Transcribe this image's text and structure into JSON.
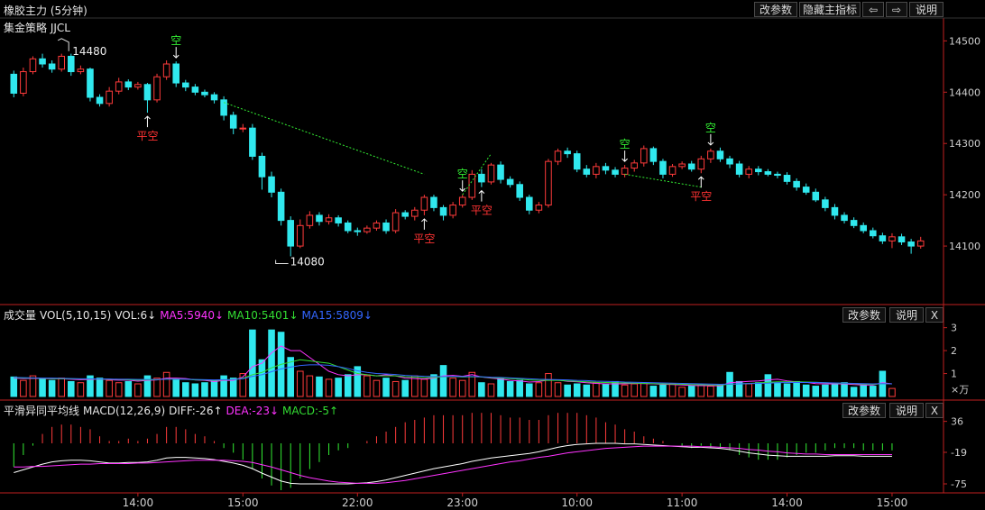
{
  "header": {
    "title": "橡胶主力 (5分钟)",
    "strategy": "集金策略 JJCL",
    "buttons": {
      "edit_params": "改参数",
      "hide_indicator": "隐藏主指标",
      "left_arrow": "⇦",
      "right_arrow": "⇨",
      "explain": "说明"
    }
  },
  "volume_panel": {
    "label": "成交量",
    "indicator": "VOL(5,10,15)",
    "vol": "VOL:6↓",
    "ma5": "MA5:5940↓",
    "ma10": "MA10:5401↓",
    "ma15": "MA15:5809↓",
    "edit_params": "改参数",
    "explain": "说明",
    "close": "X",
    "unit": "×万"
  },
  "macd_panel": {
    "label": "平滑异同平均线",
    "indicator": "MACD(12,26,9)",
    "diff": "DIFF:-26↑",
    "dea": "DEA:-23↓",
    "macd": "MACD:-5↑",
    "edit_params": "改参数",
    "explain": "说明",
    "close": "X"
  },
  "colors": {
    "up": "#ff3b3b",
    "down": "#30e8ee",
    "ma5": "#ff33ff",
    "ma10": "#33dd33",
    "ma15": "#3366ff",
    "diff": "#ffffff",
    "dea": "#ff33ff",
    "signal_short": "#33ee33",
    "signal_cover": "#ff3333",
    "trend": "#33ee33"
  },
  "chart_data": {
    "type": "candlestick",
    "price_axis": {
      "ticks": [
        14100,
        14200,
        14300,
        14400,
        14500
      ],
      "ylim": [
        14000,
        14520
      ]
    },
    "volume_axis": {
      "ticks": [
        1,
        2,
        3
      ],
      "ylim": [
        0,
        3.3
      ]
    },
    "macd_axis": {
      "ticks": [
        36,
        -19,
        -75
      ],
      "ylim": [
        -83,
        45
      ]
    },
    "time_ticks": [
      {
        "label": "14:00",
        "index": 13
      },
      {
        "label": "15:00",
        "index": 24
      },
      {
        "label": "22:00",
        "index": 36
      },
      {
        "label": "23:00",
        "index": 47
      },
      {
        "label": "10:00",
        "index": 59
      },
      {
        "label": "11:00",
        "index": 70
      },
      {
        "label": "14:00",
        "index": 81
      },
      {
        "label": "15:00",
        "index": 92
      }
    ],
    "annotations": {
      "high_label": {
        "text": "14480",
        "index": 5,
        "price": 14480
      },
      "low_label": {
        "text": "14080",
        "index": 28,
        "price": 14080
      }
    },
    "signals": [
      {
        "index": 14,
        "text": "平空",
        "type": "cover"
      },
      {
        "index": 17,
        "text": "空",
        "type": "short"
      },
      {
        "index": 43,
        "text": "平空",
        "type": "cover"
      },
      {
        "index": 47,
        "text": "空",
        "type": "short"
      },
      {
        "index": 49,
        "text": "平空",
        "type": "cover"
      },
      {
        "index": 64,
        "text": "空",
        "type": "short"
      },
      {
        "index": 72,
        "text": "平空",
        "type": "cover"
      },
      {
        "index": 73,
        "text": "空",
        "type": "short"
      }
    ],
    "trend_lines": [
      {
        "from": {
          "index": 22,
          "price": 14380
        },
        "to": {
          "index": 43,
          "price": 14240
        }
      },
      {
        "from": {
          "index": 47,
          "price": 14200
        },
        "to": {
          "index": 50,
          "price": 14280
        }
      },
      {
        "from": {
          "index": 64,
          "price": 14240
        },
        "to": {
          "index": 72,
          "price": 14215
        }
      }
    ],
    "candles": [
      [
        14435,
        14398,
        14442,
        14390
      ],
      [
        14398,
        14440,
        14448,
        14392
      ],
      [
        14440,
        14465,
        14470,
        14435
      ],
      [
        14465,
        14455,
        14475,
        14448
      ],
      [
        14455,
        14445,
        14462,
        14438
      ],
      [
        14445,
        14470,
        14475,
        14440
      ],
      [
        14470,
        14440,
        14475,
        14432
      ],
      [
        14440,
        14445,
        14452,
        14435
      ],
      [
        14445,
        14390,
        14448,
        14382
      ],
      [
        14390,
        14378,
        14396,
        14372
      ],
      [
        14378,
        14402,
        14410,
        14372
      ],
      [
        14402,
        14420,
        14428,
        14396
      ],
      [
        14420,
        14410,
        14425,
        14404
      ],
      [
        14410,
        14415,
        14420,
        14405
      ],
      [
        14415,
        14385,
        14418,
        14360
      ],
      [
        14385,
        14430,
        14436,
        14380
      ],
      [
        14430,
        14455,
        14462,
        14424
      ],
      [
        14455,
        14418,
        14460,
        14410
      ],
      [
        14418,
        14410,
        14424,
        14402
      ],
      [
        14410,
        14400,
        14416,
        14394
      ],
      [
        14400,
        14395,
        14405,
        14390
      ],
      [
        14395,
        14385,
        14400,
        14378
      ],
      [
        14385,
        14355,
        14392,
        14345
      ],
      [
        14355,
        14330,
        14362,
        14318
      ],
      [
        14330,
        14330,
        14338,
        14322
      ],
      [
        14330,
        14275,
        14338,
        14268
      ],
      [
        14275,
        14235,
        14282,
        14210
      ],
      [
        14235,
        14205,
        14245,
        14195
      ],
      [
        14205,
        14150,
        14212,
        14140
      ],
      [
        14150,
        14100,
        14158,
        14080
      ],
      [
        14100,
        14140,
        14152,
        14096
      ],
      [
        14140,
        14160,
        14168,
        14134
      ],
      [
        14160,
        14148,
        14166,
        14140
      ],
      [
        14148,
        14155,
        14162,
        14142
      ],
      [
        14155,
        14145,
        14160,
        14138
      ],
      [
        14145,
        14130,
        14150,
        14125
      ],
      [
        14130,
        14128,
        14136,
        14120
      ],
      [
        14128,
        14135,
        14140,
        14124
      ],
      [
        14135,
        14145,
        14150,
        14130
      ],
      [
        14145,
        14130,
        14152,
        14124
      ],
      [
        14130,
        14165,
        14172,
        14125
      ],
      [
        14165,
        14158,
        14170,
        14152
      ],
      [
        14158,
        14170,
        14176,
        14150
      ],
      [
        14170,
        14195,
        14200,
        14160
      ],
      [
        14195,
        14175,
        14200,
        14168
      ],
      [
        14175,
        14160,
        14180,
        14150
      ],
      [
        14160,
        14180,
        14186,
        14154
      ],
      [
        14180,
        14195,
        14200,
        14175
      ],
      [
        14195,
        14240,
        14248,
        14190
      ],
      [
        14240,
        14225,
        14250,
        14215
      ],
      [
        14225,
        14258,
        14262,
        14220
      ],
      [
        14258,
        14230,
        14265,
        14222
      ],
      [
        14230,
        14220,
        14236,
        14214
      ],
      [
        14220,
        14195,
        14226,
        14188
      ],
      [
        14195,
        14170,
        14200,
        14162
      ],
      [
        14170,
        14180,
        14186,
        14164
      ],
      [
        14180,
        14265,
        14270,
        14175
      ],
      [
        14265,
        14285,
        14290,
        14258
      ],
      [
        14285,
        14280,
        14292,
        14272
      ],
      [
        14280,
        14250,
        14286,
        14244
      ],
      [
        14250,
        14240,
        14258,
        14234
      ],
      [
        14240,
        14255,
        14262,
        14232
      ],
      [
        14255,
        14248,
        14262,
        14240
      ],
      [
        14248,
        14240,
        14254,
        14234
      ],
      [
        14240,
        14252,
        14258,
        14234
      ],
      [
        14252,
        14262,
        14268,
        14245
      ],
      [
        14262,
        14290,
        14296,
        14255
      ],
      [
        14290,
        14265,
        14294,
        14258
      ],
      [
        14265,
        14240,
        14270,
        14232
      ],
      [
        14240,
        14255,
        14260,
        14235
      ],
      [
        14255,
        14260,
        14265,
        14250
      ],
      [
        14260,
        14250,
        14266,
        14245
      ],
      [
        14250,
        14270,
        14276,
        14242
      ],
      [
        14270,
        14285,
        14290,
        14262
      ],
      [
        14285,
        14270,
        14292,
        14264
      ],
      [
        14270,
        14260,
        14276,
        14252
      ],
      [
        14260,
        14240,
        14266,
        14234
      ],
      [
        14240,
        14250,
        14256,
        14232
      ],
      [
        14250,
        14245,
        14256,
        14238
      ],
      [
        14245,
        14240,
        14250,
        14236
      ],
      [
        14240,
        14238,
        14245,
        14232
      ],
      [
        14238,
        14226,
        14244,
        14220
      ],
      [
        14226,
        14215,
        14232,
        14208
      ],
      [
        14215,
        14205,
        14222,
        14200
      ],
      [
        14205,
        14190,
        14212,
        14186
      ],
      [
        14190,
        14175,
        14196,
        14168
      ],
      [
        14175,
        14160,
        14182,
        14152
      ],
      [
        14160,
        14150,
        14166,
        14144
      ],
      [
        14150,
        14140,
        14156,
        14135
      ],
      [
        14140,
        14130,
        14146,
        14125
      ],
      [
        14130,
        14120,
        14136,
        14115
      ],
      [
        14120,
        14110,
        14126,
        14104
      ],
      [
        14110,
        14118,
        14125,
        14096
      ],
      [
        14118,
        14108,
        14124,
        14102
      ],
      [
        14108,
        14100,
        14114,
        14085
      ],
      [
        14100,
        14110,
        14118,
        14095
      ]
    ],
    "volume": [
      0.85,
      0.7,
      0.9,
      0.75,
      0.7,
      0.8,
      0.65,
      0.6,
      0.9,
      0.8,
      0.7,
      0.6,
      0.65,
      0.55,
      0.9,
      0.8,
      1.05,
      0.75,
      0.6,
      0.55,
      0.6,
      0.7,
      0.9,
      0.8,
      1.0,
      2.9,
      1.6,
      2.9,
      2.8,
      1.7,
      1.1,
      0.9,
      0.85,
      0.75,
      0.8,
      0.95,
      1.3,
      0.9,
      0.7,
      0.8,
      0.65,
      0.7,
      0.9,
      0.75,
      0.95,
      1.35,
      0.8,
      0.7,
      1.05,
      0.6,
      0.55,
      0.8,
      0.65,
      0.7,
      0.55,
      0.6,
      1.0,
      0.6,
      0.5,
      0.55,
      0.5,
      0.6,
      0.55,
      0.65,
      0.5,
      0.55,
      0.6,
      0.45,
      0.5,
      0.55,
      0.4,
      0.45,
      0.5,
      0.45,
      0.5,
      1.05,
      0.65,
      0.55,
      0.6,
      0.95,
      0.6,
      0.55,
      0.65,
      0.5,
      0.45,
      0.5,
      0.55,
      0.6,
      0.4,
      0.5,
      0.45,
      1.1,
      0.35
    ],
    "ma5": [
      0.8,
      0.78,
      0.79,
      0.78,
      0.77,
      0.77,
      0.75,
      0.73,
      0.74,
      0.76,
      0.73,
      0.71,
      0.71,
      0.67,
      0.7,
      0.72,
      0.8,
      0.8,
      0.78,
      0.72,
      0.7,
      0.65,
      0.7,
      0.7,
      0.85,
      1.3,
      1.45,
      1.9,
      2.2,
      2.0,
      2.0,
      1.7,
      1.4,
      1.1,
      0.95,
      0.9,
      0.95,
      0.95,
      0.9,
      0.95,
      0.9,
      0.8,
      0.78,
      0.76,
      0.8,
      0.9,
      0.92,
      0.88,
      0.95,
      0.85,
      0.8,
      0.76,
      0.7,
      0.68,
      0.63,
      0.65,
      0.72,
      0.72,
      0.66,
      0.64,
      0.6,
      0.57,
      0.55,
      0.55,
      0.55,
      0.57,
      0.56,
      0.55,
      0.53,
      0.52,
      0.5,
      0.48,
      0.47,
      0.47,
      0.46,
      0.6,
      0.63,
      0.66,
      0.68,
      0.72,
      0.75,
      0.68,
      0.64,
      0.62,
      0.56,
      0.55,
      0.55,
      0.55,
      0.52,
      0.5,
      0.5,
      0.6,
      0.55
    ],
    "ma10": [
      0.82,
      0.8,
      0.8,
      0.79,
      0.78,
      0.77,
      0.77,
      0.76,
      0.76,
      0.76,
      0.75,
      0.74,
      0.73,
      0.71,
      0.72,
      0.73,
      0.76,
      0.76,
      0.75,
      0.72,
      0.72,
      0.7,
      0.72,
      0.74,
      0.79,
      0.95,
      1.05,
      1.25,
      1.4,
      1.5,
      1.6,
      1.55,
      1.5,
      1.45,
      1.3,
      1.15,
      1.0,
      0.95,
      0.9,
      0.9,
      0.9,
      0.86,
      0.84,
      0.82,
      0.83,
      0.86,
      0.87,
      0.85,
      0.86,
      0.85,
      0.82,
      0.8,
      0.78,
      0.76,
      0.72,
      0.7,
      0.7,
      0.7,
      0.68,
      0.66,
      0.64,
      0.62,
      0.61,
      0.6,
      0.59,
      0.58,
      0.57,
      0.56,
      0.55,
      0.54,
      0.53,
      0.52,
      0.51,
      0.5,
      0.5,
      0.53,
      0.55,
      0.57,
      0.59,
      0.62,
      0.64,
      0.64,
      0.64,
      0.63,
      0.62,
      0.6,
      0.58,
      0.57,
      0.56,
      0.54,
      0.53,
      0.56,
      0.55
    ],
    "ma15": [
      0.83,
      0.82,
      0.81,
      0.8,
      0.8,
      0.79,
      0.78,
      0.77,
      0.77,
      0.76,
      0.76,
      0.75,
      0.75,
      0.74,
      0.74,
      0.74,
      0.75,
      0.75,
      0.75,
      0.74,
      0.73,
      0.72,
      0.73,
      0.74,
      0.77,
      0.88,
      0.95,
      1.08,
      1.2,
      1.28,
      1.35,
      1.38,
      1.38,
      1.36,
      1.3,
      1.22,
      1.12,
      1.05,
      1.0,
      0.98,
      0.96,
      0.92,
      0.9,
      0.88,
      0.87,
      0.87,
      0.88,
      0.87,
      0.87,
      0.86,
      0.84,
      0.83,
      0.81,
      0.79,
      0.77,
      0.75,
      0.74,
      0.73,
      0.72,
      0.7,
      0.69,
      0.67,
      0.66,
      0.65,
      0.63,
      0.62,
      0.61,
      0.6,
      0.59,
      0.58,
      0.57,
      0.56,
      0.55,
      0.54,
      0.53,
      0.54,
      0.55,
      0.56,
      0.57,
      0.58,
      0.6,
      0.61,
      0.61,
      0.61,
      0.61,
      0.6,
      0.59,
      0.58,
      0.57,
      0.56,
      0.55,
      0.56,
      0.55
    ],
    "diff": [
      -55,
      -50,
      -45,
      -40,
      -36,
      -34,
      -33,
      -33,
      -34,
      -36,
      -38,
      -38,
      -37,
      -37,
      -36,
      -33,
      -29,
      -28,
      -28,
      -29,
      -30,
      -32,
      -35,
      -38,
      -42,
      -48,
      -56,
      -63,
      -70,
      -74,
      -75,
      -75,
      -75,
      -75,
      -75,
      -75,
      -74,
      -73,
      -71,
      -68,
      -64,
      -60,
      -56,
      -52,
      -48,
      -45,
      -42,
      -39,
      -35,
      -32,
      -29,
      -27,
      -25,
      -23,
      -21,
      -18,
      -14,
      -10,
      -7,
      -5,
      -4,
      -3,
      -3,
      -3,
      -4,
      -4,
      -5,
      -6,
      -7,
      -8,
      -9,
      -10,
      -10,
      -11,
      -12,
      -14,
      -17,
      -20,
      -22,
      -24,
      -25,
      -26,
      -26,
      -26,
      -26,
      -26,
      -25,
      -25,
      -25,
      -26,
      -26,
      -26,
      -26
    ],
    "dea": [
      -45,
      -45,
      -44,
      -44,
      -43,
      -42,
      -41,
      -40,
      -40,
      -39,
      -39,
      -39,
      -39,
      -38,
      -38,
      -37,
      -36,
      -35,
      -34,
      -33,
      -33,
      -33,
      -33,
      -34,
      -35,
      -37,
      -41,
      -45,
      -50,
      -55,
      -60,
      -64,
      -67,
      -70,
      -72,
      -73,
      -74,
      -74,
      -74,
      -73,
      -71,
      -69,
      -66,
      -63,
      -60,
      -57,
      -54,
      -51,
      -48,
      -45,
      -42,
      -39,
      -36,
      -34,
      -31,
      -28,
      -26,
      -23,
      -20,
      -18,
      -16,
      -14,
      -12,
      -11,
      -10,
      -9,
      -8,
      -8,
      -8,
      -8,
      -8,
      -8,
      -9,
      -9,
      -10,
      -11,
      -12,
      -14,
      -15,
      -17,
      -18,
      -20,
      -21,
      -22,
      -22,
      -23,
      -23,
      -23,
      -23,
      -23,
      -23,
      -23,
      -23
    ]
  }
}
